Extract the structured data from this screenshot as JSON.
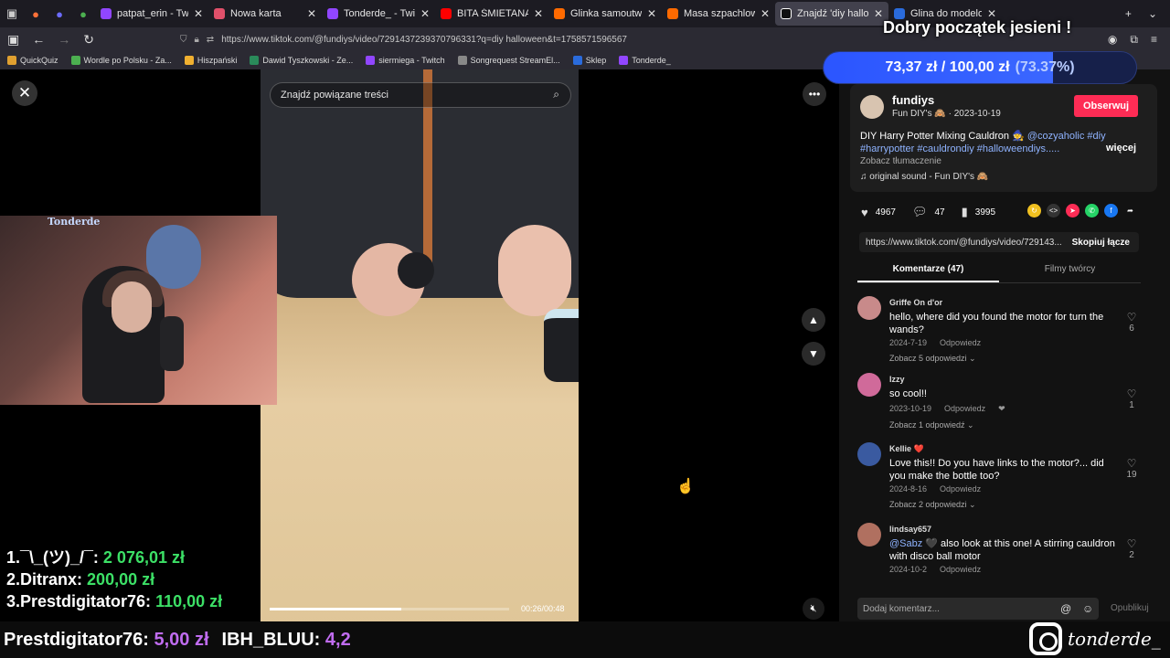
{
  "browser": {
    "tabs": [
      {
        "label": "patpat_erin - Twitch",
        "color": "#9146ff"
      },
      {
        "label": "Nowa karta",
        "color": "#e0506a"
      },
      {
        "label": "Tonderde_ - Twitch",
        "color": "#9146ff"
      },
      {
        "label": "BITA ŚMIETANA Z WOSK",
        "color": "#ff0000"
      },
      {
        "label": "Glinka samoutwardzalna",
        "color": "#ff6a00"
      },
      {
        "label": "Masa szpachlowa naprav",
        "color": "#ff6a00"
      },
      {
        "label": "Znajdź 'diy halloween' n",
        "color": "#111111"
      },
      {
        "label": "Glina do modelowania b",
        "color": "#2a6bdc"
      }
    ],
    "url": "https://www.tiktok.com/@fundiys/video/7291437239370796331?q=diy halloween&t=1758571596567",
    "bookmarks": [
      {
        "label": "QuickQuiz",
        "color": "#e0a030"
      },
      {
        "label": "Wordle po Polsku - Za...",
        "color": "#4caf50"
      },
      {
        "label": "Hiszpański",
        "color": "#f0b030"
      },
      {
        "label": "Dawid Tyszkowski - Ze...",
        "color": "#2a8a5a"
      },
      {
        "label": "siermiega - Twitch",
        "color": "#9146ff"
      },
      {
        "label": "Songrequest StreamEl...",
        "color": "#888888"
      },
      {
        "label": "Sklep",
        "color": "#2a6bdc"
      },
      {
        "label": "Tonderde_",
        "color": "#9146ff"
      }
    ]
  },
  "video": {
    "search_placeholder": "Znajdź powiązane treści",
    "time": "00:26/00:48",
    "progress": 0.55
  },
  "stream": {
    "webcam_label": "Tonderde",
    "donors": [
      {
        "rank": "1.",
        "name": "¯\\_(ツ)_/¯:",
        "amount": "2 076,01 zł"
      },
      {
        "rank": "2.",
        "name": "Ditranx:",
        "amount": "200,00 zł"
      },
      {
        "rank": "3.",
        "name": "Prestdigitator76:",
        "amount": "110,00 zł"
      }
    ],
    "ticker": [
      {
        "name": "Prestdigitator76:",
        "amount": "5,00 zł"
      },
      {
        "name": "IBH_BLUU:",
        "amount": "4,2"
      }
    ],
    "instagram": "tonderde_",
    "goal": {
      "title": "Dobry początek jesieni !",
      "current": "73,37 zł",
      "sep": "/",
      "target": "100,00 zł",
      "percent": "(73.37%)",
      "fraction": 0.7337
    }
  },
  "post": {
    "username": "fundiys",
    "display": "Fun DIY's 🙈 · 2023-10-19",
    "follow": "Obserwuj",
    "desc_text": "DIY Harry Potter Mixing Cauldron 🧙 ",
    "desc_tags": "@cozyaholic #diy #harrypotter #cauldrondiy #halloweendiys.....",
    "more": "więcej",
    "translate": "Zobacz tłumaczenie",
    "sound": "♫  original sound - Fun DIY's 🙈",
    "likes": "4967",
    "comments_count": "47",
    "saves": "3995",
    "link": "https://www.tiktok.com/@fundiys/video/729143...",
    "copy": "Skopiuj łącze",
    "tab_comments": "Komentarze (47)",
    "tab_creator": "Filmy twórcy"
  },
  "comments": [
    {
      "user": "Griffe On d'or",
      "text": "hello, where did you found the motor for turn the wands?",
      "date": "2024-7-19",
      "reply": "Odpowiedz",
      "replies": "Zobacz 5 odpowiedzi ⌄",
      "likes": "6",
      "color": "#c88a8a"
    },
    {
      "user": "Izzy",
      "text": "so cool!!",
      "date": "2023-10-19",
      "reply": "Odpowiedz",
      "replies": "Zobacz 1 odpowiedź ⌄",
      "likes": "1",
      "color": "#d06a9a"
    },
    {
      "user": "Kellie ❤️",
      "text": "Love this!! Do you have links to the motor?... did you make the bottle too?",
      "date": "2024-8-16",
      "reply": "Odpowiedz",
      "replies": "Zobacz 2 odpowiedzi ⌄",
      "likes": "19",
      "color": "#3a5aa0"
    },
    {
      "user": "lindsay657",
      "mention": "@Sabz 🖤",
      "text": " also look at this one! A stirring cauldron with disco ball motor",
      "date": "2024-10-2",
      "reply": "Odpowiedz",
      "replies": "",
      "likes": "2",
      "color": "#b07060"
    }
  ],
  "add_comment": {
    "placeholder": "Dodaj komentarz...",
    "publish": "Opublikuj"
  }
}
